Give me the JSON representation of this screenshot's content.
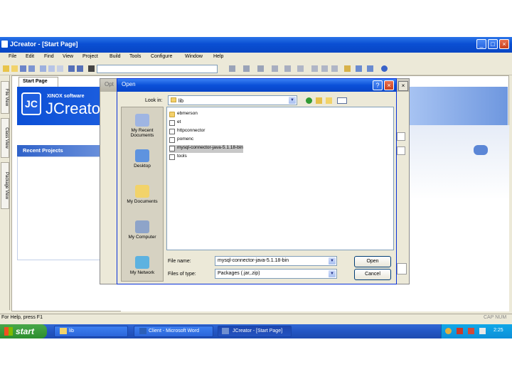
{
  "window": {
    "title": "JCreator - [Start Page]",
    "minimize": "_",
    "maximize": "□",
    "close": "×"
  },
  "menu": [
    "File",
    "Edit",
    "Find",
    "View",
    "Project",
    "Build",
    "Tools",
    "Configure",
    "Window",
    "Help"
  ],
  "sidetabs": [
    "File View",
    "Class View",
    "Package View"
  ],
  "start_page": {
    "tab": "Start Page",
    "brand_small": "XINOX software",
    "brand_big": "JCreato",
    "logo": "JC",
    "recent_projects": "Recent Projects"
  },
  "options_dialog": {
    "title": "Opt"
  },
  "open_dialog": {
    "title": "Open",
    "help": "?",
    "close": "×",
    "look_in_label": "Look in:",
    "look_in_value": "lib",
    "places": [
      "My Recent Documents",
      "Desktop",
      "My Documents",
      "My Computer",
      "My Network"
    ],
    "files": [
      {
        "name": "ebmerson",
        "type": "folder",
        "selected": false
      },
      {
        "name": "et",
        "type": "file",
        "selected": false
      },
      {
        "name": "httpconnector",
        "type": "file",
        "selected": false
      },
      {
        "name": "pomenc",
        "type": "file",
        "selected": false
      },
      {
        "name": "mysql-connector-java-5.1.18-bin",
        "type": "file",
        "selected": true
      },
      {
        "name": "tools",
        "type": "file",
        "selected": false
      }
    ],
    "file_name_label": "File name:",
    "file_name_value": "mysql-connector-java-5.1.18-bin",
    "file_type_label": "Files of type:",
    "file_type_value": "Packages (.jar,.zip)",
    "open_button": "Open",
    "cancel_button": "Cancel"
  },
  "status": {
    "left": "For Help, press F1",
    "right": "CAP NUM"
  },
  "taskbar": {
    "start": "start",
    "tasks": [
      {
        "label": "lib",
        "active": false
      },
      {
        "label": "Client - Microsoft Word",
        "active": false
      },
      {
        "label": "JCreator - [Start Page]",
        "active": true
      }
    ],
    "clock": "2:25"
  },
  "colors": {
    "title_blue": "#0a4fd3",
    "taskbar_blue": "#2356c4",
    "start_green": "#2c8e2e",
    "dialog_bg": "#ece9d8"
  }
}
